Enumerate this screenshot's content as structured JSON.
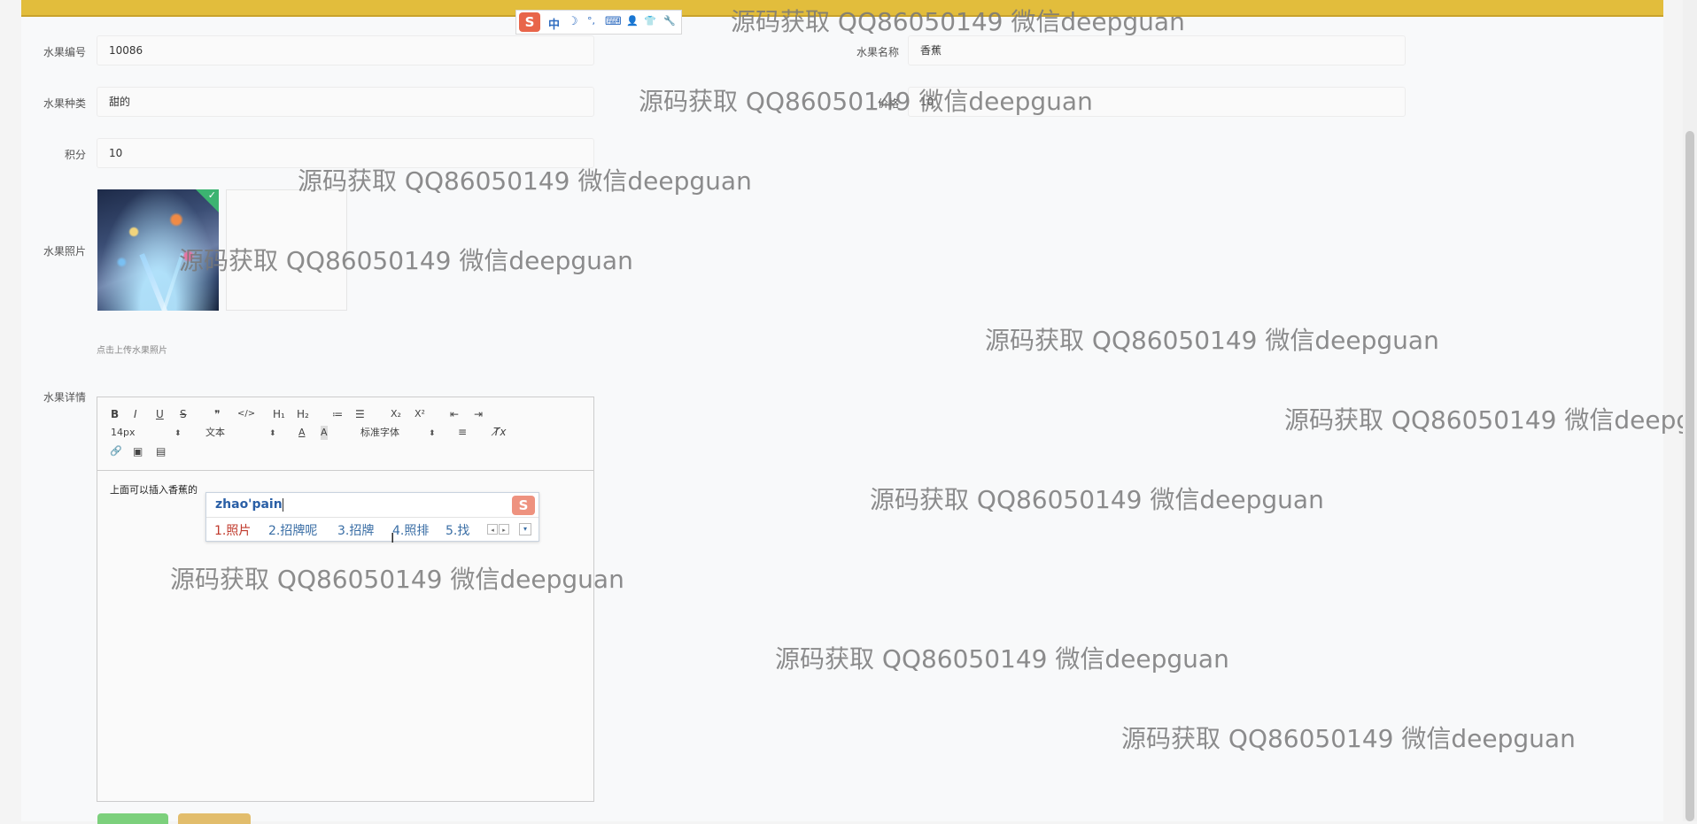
{
  "form": {
    "fruit_id_label": "水果编号",
    "fruit_id_value": "10086",
    "fruit_name_label": "水果名称",
    "fruit_name_value": "香蕉",
    "fruit_type_label": "水果种类",
    "fruit_type_value": "甜的",
    "price_label": "价格",
    "price_value": "10",
    "points_label": "积分",
    "points_value": "10",
    "photo_label": "水果照片",
    "photo_hint": "点击上传水果照片",
    "detail_label": "水果详情"
  },
  "editor": {
    "toolbar": {
      "bold": "B",
      "italic": "I",
      "underline": "U",
      "strike": "S",
      "blockquote": "❞",
      "code": "</>",
      "h1": "H₁",
      "h2": "H₂",
      "ordered_list": "≔",
      "bullet_list": "☰",
      "subscript": "X₂",
      "superscript": "X²",
      "outdent": "⇤",
      "indent": "⇥",
      "size": "14px",
      "format": "文本",
      "font": "标准字体",
      "align": "≡",
      "clean": "T̸x",
      "link": "🔗",
      "image": "▣",
      "video": "▤"
    },
    "content": "上面可以插入香蕉的"
  },
  "ime": {
    "pinyin": "zhao'pain",
    "candidates": [
      "1.照片",
      "2.招牌呢",
      "3.招牌",
      "4.照排",
      "5.找"
    ],
    "logo": "S",
    "prev": "◂",
    "next": "▸",
    "more": "▾"
  },
  "ime_toolbar": {
    "logo": "S",
    "items": [
      "中",
      "☽",
      "°,",
      "⌨",
      "👤",
      "👕",
      "🔧"
    ]
  },
  "watermark": "源码获取 QQ86050149 微信deepguan",
  "colors": {
    "header_bar": "#e2bd3c",
    "save_button": "#7cd07c",
    "reset_button": "#e2bd6c",
    "ime_candidate_active": "#c0392b"
  }
}
